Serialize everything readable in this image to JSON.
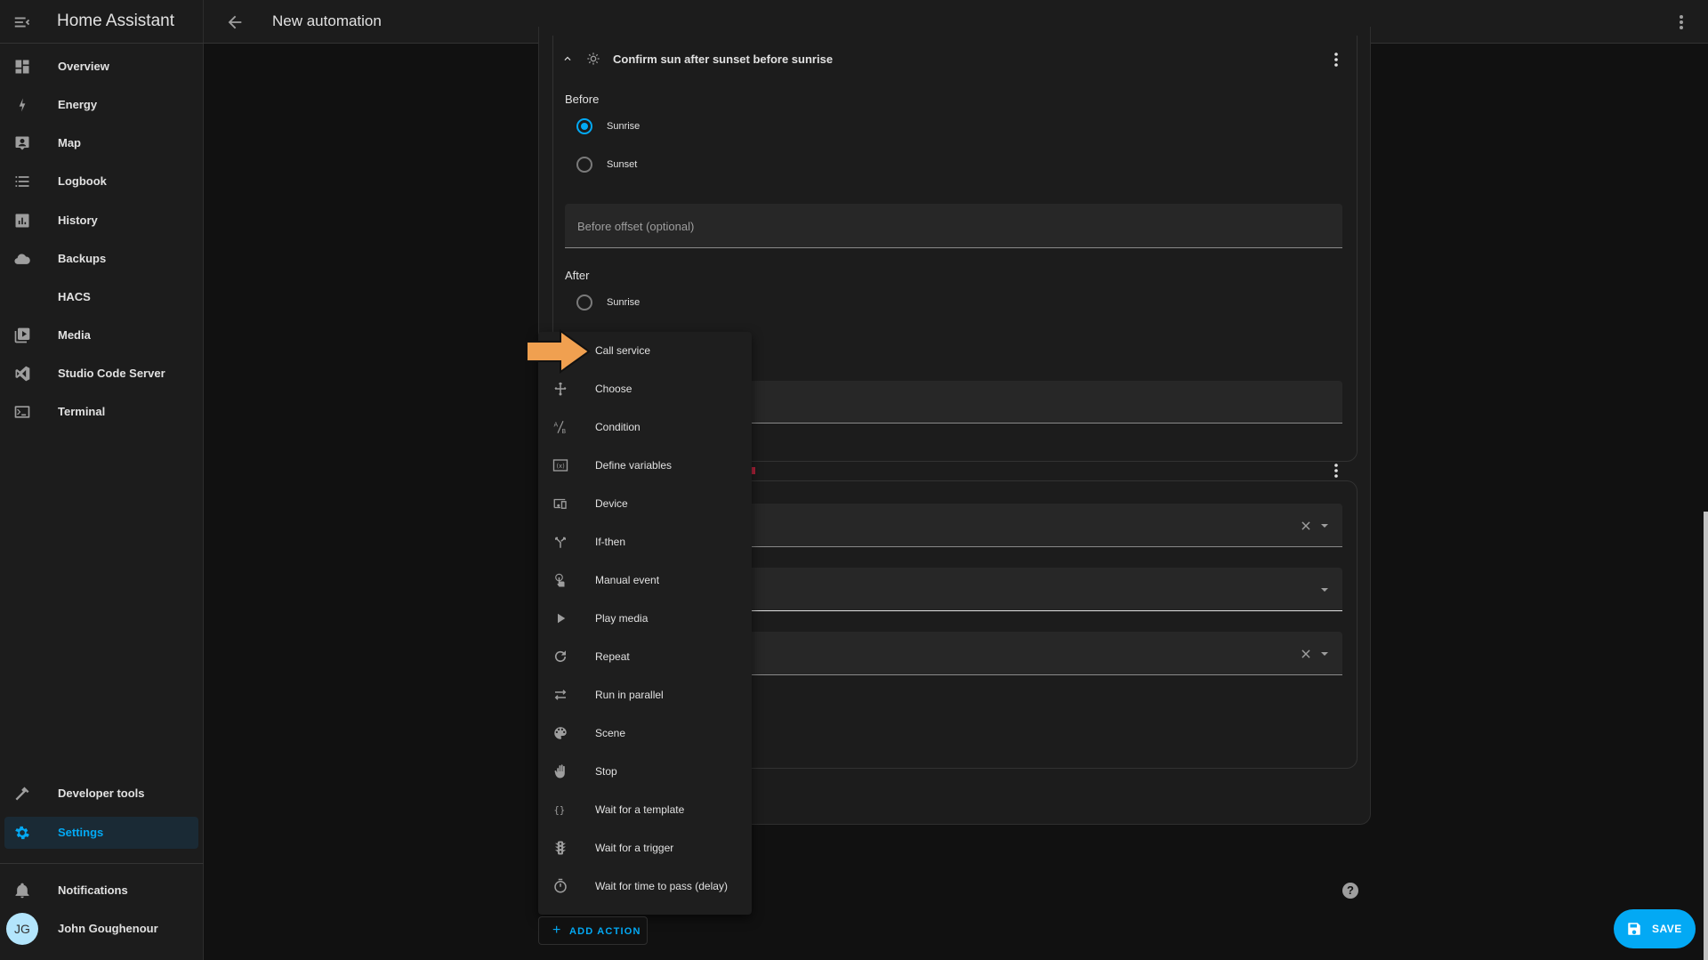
{
  "app": {
    "title": "Home Assistant"
  },
  "header": {
    "title": "New automation"
  },
  "sidebar": {
    "items": [
      {
        "label": "Overview",
        "icon": "view-dashboard-icon"
      },
      {
        "label": "Energy",
        "icon": "lightning-bolt-icon"
      },
      {
        "label": "Map",
        "icon": "map-account-icon"
      },
      {
        "label": "Logbook",
        "icon": "format-list-bulleted-icon"
      },
      {
        "label": "History",
        "icon": "chart-box-icon"
      },
      {
        "label": "Backups",
        "icon": "cloud-icon"
      },
      {
        "label": "HACS",
        "icon": ""
      },
      {
        "label": "Media",
        "icon": "play-box-multiple-icon"
      },
      {
        "label": "Studio Code Server",
        "icon": "vscode-icon"
      },
      {
        "label": "Terminal",
        "icon": "console-icon"
      }
    ],
    "bottom_items": [
      {
        "label": "Developer tools",
        "icon": "hammer-icon"
      },
      {
        "label": "Settings",
        "icon": "cog-icon",
        "active": true
      }
    ],
    "notifications_label": "Notifications",
    "user": {
      "name": "John Goughenour",
      "initials": "JG"
    }
  },
  "condition_card": {
    "title": "Confirm sun after sunset before sunrise",
    "before": {
      "label": "Before",
      "options": [
        {
          "label": "Sunrise",
          "checked": true
        },
        {
          "label": "Sunset",
          "checked": false
        }
      ],
      "offset_placeholder": "Before offset (optional)"
    },
    "after": {
      "label": "After",
      "options": [
        {
          "label": "Sunrise",
          "checked": false
        }
      ]
    }
  },
  "action_menu": {
    "items": [
      {
        "label": "Call service",
        "icon": "room-service-icon"
      },
      {
        "label": "Choose",
        "icon": "arrow-decision-icon"
      },
      {
        "label": "Condition",
        "icon": "a-b-testing-icon"
      },
      {
        "label": "Define variables",
        "icon": "variable-box-icon"
      },
      {
        "label": "Device",
        "icon": "devices-icon"
      },
      {
        "label": "If-then",
        "icon": "call-split-icon"
      },
      {
        "label": "Manual event",
        "icon": "gesture-tap-icon"
      },
      {
        "label": "Play media",
        "icon": "play-icon"
      },
      {
        "label": "Repeat",
        "icon": "refresh-icon"
      },
      {
        "label": "Run in parallel",
        "icon": "shuffle-disabled-icon"
      },
      {
        "label": "Scene",
        "icon": "palette-icon"
      },
      {
        "label": "Stop",
        "icon": "hand-back-right-icon"
      },
      {
        "label": "Wait for a template",
        "icon": "code-braces-icon"
      },
      {
        "label": "Wait for a trigger",
        "icon": "traffic-light-icon"
      },
      {
        "label": "Wait for time to pass (delay)",
        "icon": "timer-outline-icon"
      }
    ]
  },
  "buttons": {
    "add_action": "ADD ACTION",
    "save": "SAVE",
    "help": "?"
  },
  "colors": {
    "accent": "#03a9f4",
    "arrow": "#f0a050"
  }
}
